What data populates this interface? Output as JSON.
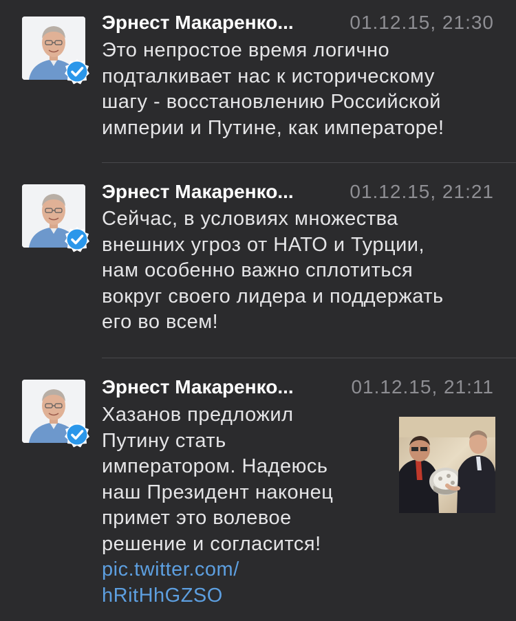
{
  "tweets": [
    {
      "author": "Эрнест Макаренко...",
      "time": "01.12.15, 21:30",
      "lines": [
        "Это непростое время логично",
        "подталкивает нас к историческому",
        "шагу - восстановлению Российской",
        "империи и Путине, как императоре!"
      ]
    },
    {
      "author": "Эрнест Макаренко...",
      "time": "01.12.15, 21:21",
      "lines": [
        "Сейчас, в условиях множества",
        "внешних угроз от НАТО и Турции,",
        "нам особенно важно сплотиться",
        "вокруг своего лидера и поддержать",
        "его во всем!"
      ]
    },
    {
      "author": "Эрнест Макаренко...",
      "time": "01.12.15, 21:11",
      "lines": [
        "Хазанов предложил",
        "Путину стать",
        "императором. Надеюсь",
        "наш Президент наконец",
        "примет это волевое",
        "решение и согласится!"
      ],
      "link_lines": [
        "pic.twitter.com/",
        "hRitHhGZSO"
      ]
    }
  ],
  "icons": {
    "verified": "verified-badge-icon"
  },
  "colors": {
    "background": "#2b2b2d",
    "author": "#ffffff",
    "text": "#e5e5e7",
    "time": "#8e8e93",
    "link": "#5d9fe0",
    "verified": "#2b97ea"
  }
}
